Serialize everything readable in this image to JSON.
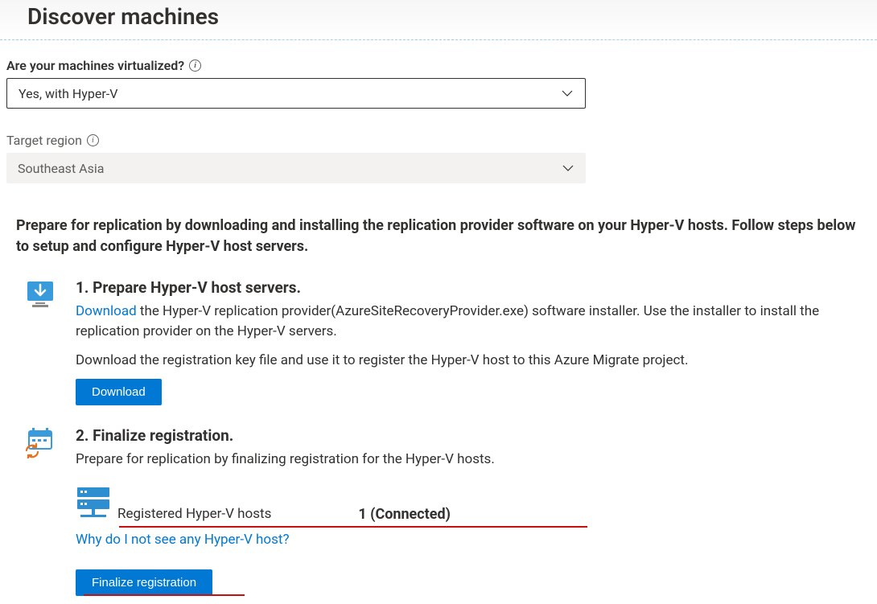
{
  "header": {
    "title": "Discover machines"
  },
  "fields": {
    "virtualized": {
      "label": "Are your machines virtualized?",
      "value": "Yes, with Hyper-V"
    },
    "region": {
      "label": "Target region",
      "value": "Southeast Asia"
    }
  },
  "intro": "Prepare for replication by downloading and installing the replication provider software on your Hyper-V hosts. Follow steps below to setup and configure Hyper-V host servers.",
  "step1": {
    "title": "1. Prepare Hyper-V host servers.",
    "download_link": "Download",
    "text_after_link": " the Hyper-V replication provider(AzureSiteRecoveryProvider.exe) software installer. Use the installer to install the replication provider on the Hyper-V servers.",
    "second_line": "Download the registration key file and use it to register the Hyper-V host to this Azure Migrate project.",
    "button": "Download"
  },
  "step2": {
    "title": "2. Finalize registration.",
    "subtitle": "Prepare for replication by finalizing registration for the Hyper-V hosts.",
    "hosts_label": "Registered Hyper-V hosts",
    "hosts_value": "1 (Connected)",
    "help_link": "Why do I not see any Hyper-V host?",
    "button": "Finalize registration"
  }
}
